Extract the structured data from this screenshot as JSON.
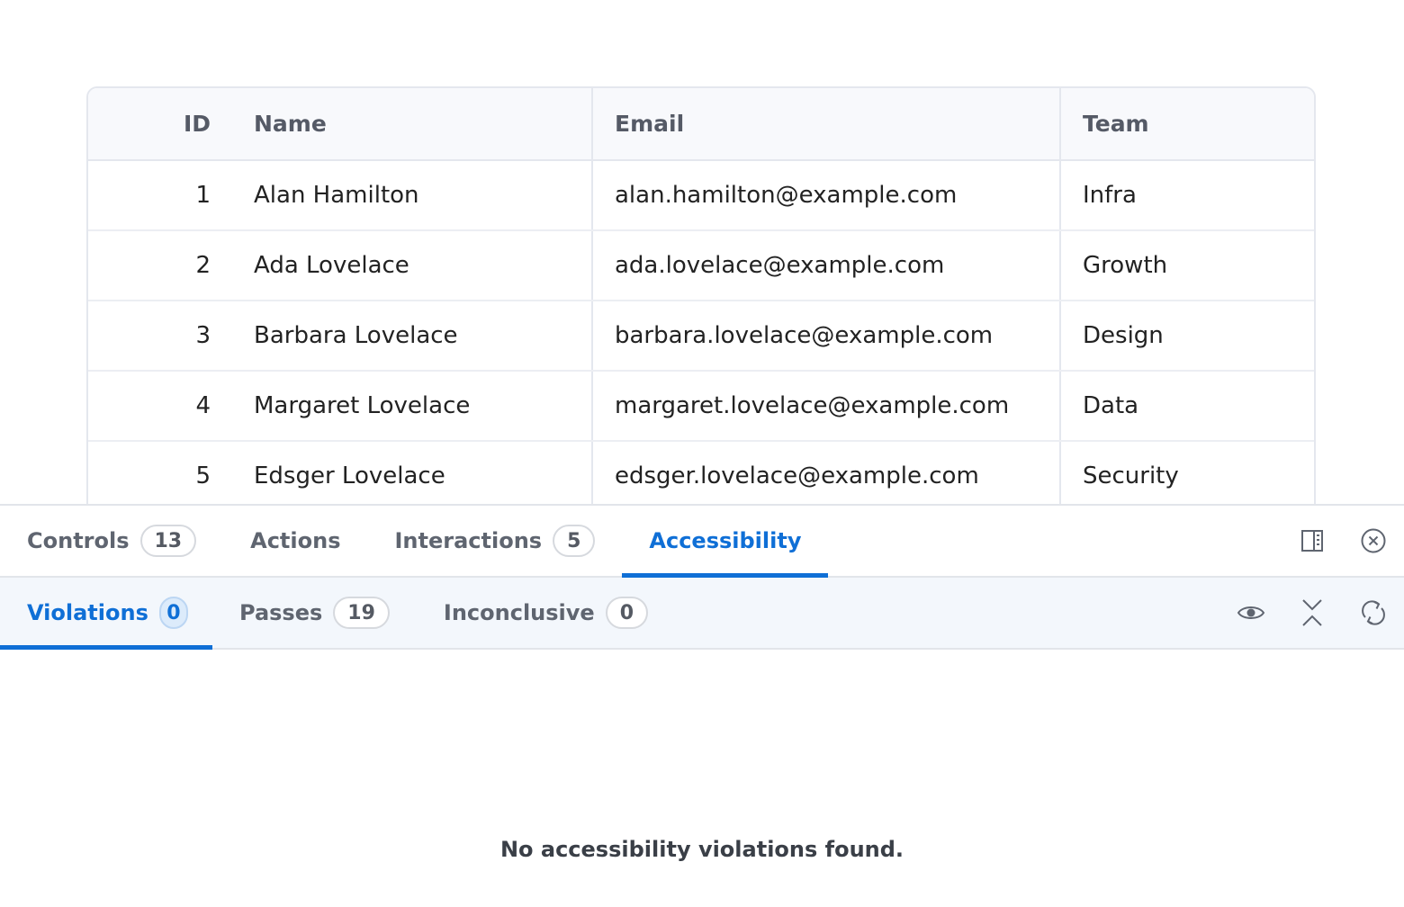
{
  "table": {
    "headers": {
      "id": "ID",
      "name": "Name",
      "email": "Email",
      "team": "Team"
    },
    "rows": [
      {
        "id": "1",
        "name": "Alan Hamilton",
        "email": "alan.hamilton@example.com",
        "team": "Infra"
      },
      {
        "id": "2",
        "name": "Ada Lovelace",
        "email": "ada.lovelace@example.com",
        "team": "Growth"
      },
      {
        "id": "3",
        "name": "Barbara Lovelace",
        "email": "barbara.lovelace@example.com",
        "team": "Design"
      },
      {
        "id": "4",
        "name": "Margaret Lovelace",
        "email": "margaret.lovelace@example.com",
        "team": "Data"
      },
      {
        "id": "5",
        "name": "Edsger Lovelace",
        "email": "edsger.lovelace@example.com",
        "team": "Security"
      }
    ]
  },
  "panel": {
    "tabs": [
      {
        "label": "Controls",
        "count": "13"
      },
      {
        "label": "Actions"
      },
      {
        "label": "Interactions",
        "count": "5"
      },
      {
        "label": "Accessibility",
        "active": true
      }
    ],
    "toolbar_icons": [
      "sidebar-layout-icon",
      "close-circle-icon"
    ],
    "subtabs": [
      {
        "label": "Violations",
        "count": "0",
        "active": true
      },
      {
        "label": "Passes",
        "count": "19"
      },
      {
        "label": "Inconclusive",
        "count": "0"
      }
    ],
    "subtoolbar_icons": [
      "eye-icon",
      "collapse-icon",
      "rerun-icon"
    ],
    "empty_message": "No accessibility violations found."
  },
  "colors": {
    "accent": "#0f6fd6",
    "tab_text": "#5f6570",
    "subbar_bg": "#f3f7fc"
  }
}
